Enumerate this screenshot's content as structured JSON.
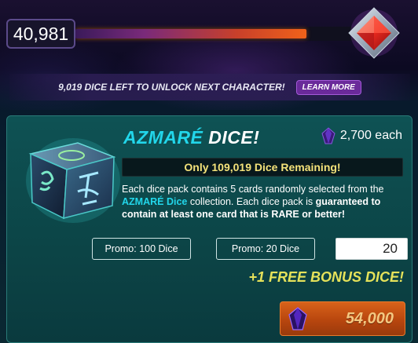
{
  "progress": {
    "score": "40,981",
    "fill_fraction": 0.8
  },
  "unlock": {
    "message": "9,019 DICE LEFT TO UNLOCK NEXT CHARACTER!",
    "learn_more_label": "LEARN MORE"
  },
  "pack": {
    "title_accent": "AZMARÉ",
    "title_rest": "DICE!",
    "price": "2,700 each",
    "remaining": "Only 109,019 Dice Remaining!",
    "desc_part1": "Each dice pack contains 5 cards randomly selected from the ",
    "desc_highlight": "AZMARÉ Dice",
    "desc_part2": " collection. Each dice pack is ",
    "desc_bold": "guaranteed to contain at least one card that is RARE or better!",
    "promo_buttons": [
      {
        "label": "Promo: 100 Dice"
      },
      {
        "label": "Promo: 20 Dice"
      }
    ],
    "quantity": "20",
    "bonus": "+1 FREE BONUS DICE!",
    "total_cost": "54,000"
  },
  "colors": {
    "accent_cyan": "#22d6ea",
    "bonus_yellow": "#e6e25a",
    "remaining_yellow": "#f4e27a",
    "buy_orange": "#c8521a",
    "card_teal": "#0e5254"
  },
  "icons": {
    "top_gem": "red-diamond-gem-icon",
    "price_gem": "purple-crystal-icon",
    "dice": "azmare-dice-icon"
  }
}
